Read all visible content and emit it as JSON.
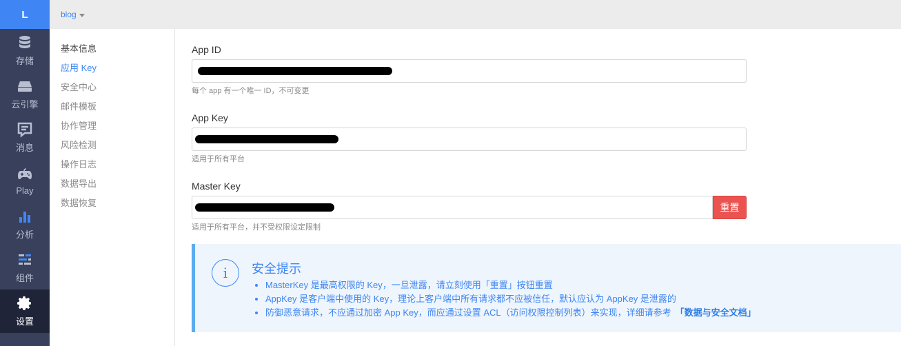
{
  "rail": {
    "logo": "L",
    "items": [
      {
        "label": "存储",
        "icon": "database-icon"
      },
      {
        "label": "云引擎",
        "icon": "cloud-engine-icon"
      },
      {
        "label": "消息",
        "icon": "message-icon"
      },
      {
        "label": "Play",
        "icon": "gamepad-icon"
      },
      {
        "label": "分析",
        "icon": "bar-chart-icon"
      },
      {
        "label": "组件",
        "icon": "components-icon"
      },
      {
        "label": "设置",
        "icon": "gear-icon",
        "active": true
      }
    ]
  },
  "topbar": {
    "app_name": "blog"
  },
  "submenu": {
    "items": [
      {
        "label": "基本信息",
        "state": "header"
      },
      {
        "label": "应用 Key",
        "state": "active"
      },
      {
        "label": "安全中心"
      },
      {
        "label": "邮件模板"
      },
      {
        "label": "协作管理"
      },
      {
        "label": "风险检测"
      },
      {
        "label": "操作日志"
      },
      {
        "label": "数据导出"
      },
      {
        "label": "数据恢复"
      }
    ]
  },
  "fields": {
    "app_id": {
      "label": "App ID",
      "help": "每个 app 有一个唯一 ID，不可变更"
    },
    "app_key": {
      "label": "App Key",
      "help": "适用于所有平台"
    },
    "master_key": {
      "label": "Master Key",
      "help": "适用于所有平台，并不受权限设定限制",
      "reset_label": "重置"
    }
  },
  "tip": {
    "icon": "i",
    "title": "安全提示",
    "items": [
      "MasterKey 是最高权限的 Key，一旦泄露，请立刻使用「重置」按钮重置",
      "AppKey 是客户端中使用的 Key，理论上客户端中所有请求都不应被信任，默认应认为 AppKey 是泄露的",
      "防御恶意请求，不应通过加密 App Key，而应通过设置 ACL（访问权限控制列表）来实现，详细请参考"
    ],
    "doc_link": "「数据与安全文档」"
  },
  "colors": {
    "accent": "#3f86f4",
    "rail_bg": "#38405c",
    "danger": "#ea5350",
    "tip_bg": "#eef5fc"
  }
}
